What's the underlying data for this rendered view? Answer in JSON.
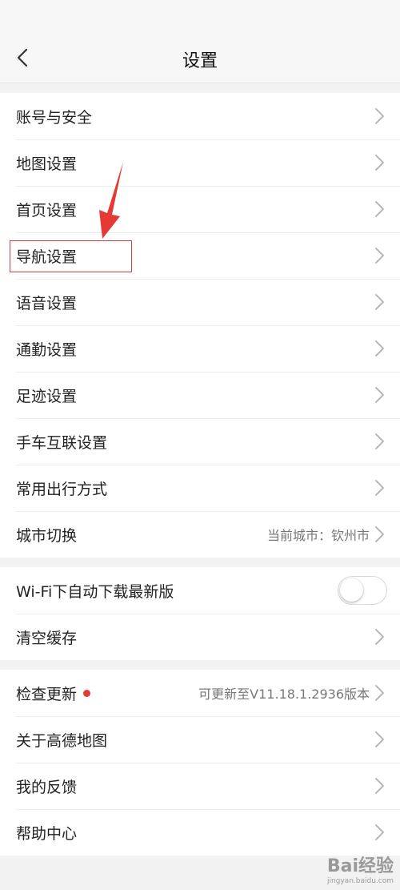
{
  "header": {
    "title": "设置"
  },
  "groups": [
    {
      "items": [
        {
          "label": "账号与安全"
        },
        {
          "label": "地图设置"
        },
        {
          "label": "首页设置"
        },
        {
          "label": "导航设置"
        },
        {
          "label": "语音设置"
        },
        {
          "label": "通勤设置"
        },
        {
          "label": "足迹设置"
        },
        {
          "label": "手车互联设置"
        },
        {
          "label": "常用出行方式"
        },
        {
          "label": "城市切换",
          "value": "当前城市：钦州市"
        }
      ]
    },
    {
      "items": [
        {
          "label": "Wi-Fi下自动下载最新版",
          "toggle": false
        },
        {
          "label": "清空缓存"
        }
      ]
    },
    {
      "items": [
        {
          "label": "检查更新",
          "value": "可更新至V11.18.1.2936版本"
        },
        {
          "label": "关于高德地图"
        },
        {
          "label": "我的反馈"
        },
        {
          "label": "帮助中心"
        }
      ]
    }
  ],
  "colors": {
    "badge": "#e53935",
    "annotation": "#e53935"
  },
  "watermark": {
    "logo": "Bai经验",
    "url": "jingyan.baidu.com"
  }
}
